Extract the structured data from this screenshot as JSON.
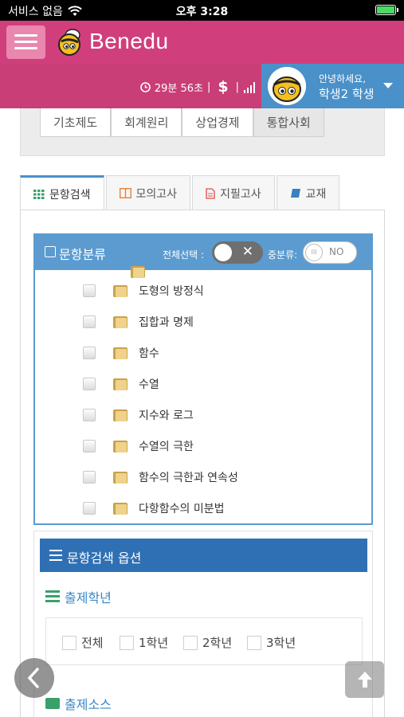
{
  "status_bar": {
    "carrier": "서비스 없음",
    "time": "오후 3:28"
  },
  "app": {
    "brand": "Benedu"
  },
  "user_bar": {
    "timer": "29분 56초",
    "separator": "|",
    "currency_symbol": "$",
    "greeting": "안녕하세요,",
    "user_name": "학생2 학생"
  },
  "subject_tabs": [
    "기초제도",
    "회계원리",
    "상업경제",
    "통합사회"
  ],
  "tabs": [
    {
      "label": "문항검색",
      "icon": "grid-icon",
      "active": true
    },
    {
      "label": "모의고사",
      "icon": "book-open-icon",
      "active": false
    },
    {
      "label": "지필고사",
      "icon": "document-icon",
      "active": false
    },
    {
      "label": "교재",
      "icon": "book-icon",
      "active": false
    }
  ],
  "category": {
    "title": "문항분류",
    "select_all_label": "전체선택 :",
    "mid_label": "중분류:",
    "toggle_off_label": "NO",
    "toggle_on_symbol": "✕",
    "items": [
      "도형의 방정식",
      "집합과 명제",
      "함수",
      "수열",
      "지수와 로그",
      "수열의 극한",
      "함수의 극한과 연속성",
      "다항함수의 미분법"
    ]
  },
  "options": {
    "title": "문항검색 옵션",
    "grade_title": "출제학년",
    "grades": [
      "전체",
      "1학년",
      "2학년",
      "3학년"
    ],
    "source_title": "출제소스"
  },
  "colors": {
    "header": "#d03f7c",
    "user_box": "#4a90c9",
    "accent": "#5b9bd0",
    "option_head": "#2f70b4"
  }
}
